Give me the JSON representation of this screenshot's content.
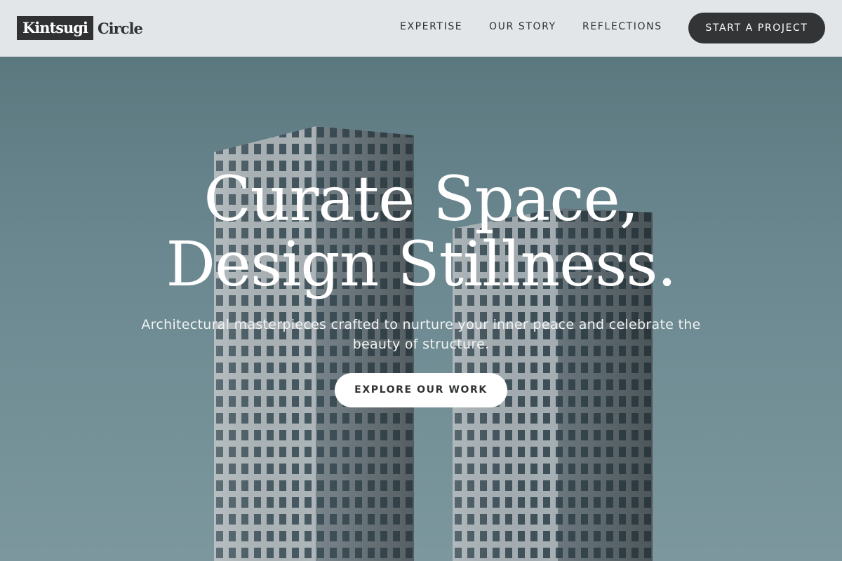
{
  "brand": {
    "logo_part1": "Kintsugi",
    "logo_part2": "Circle"
  },
  "nav": {
    "items": [
      {
        "label": "EXPERTISE"
      },
      {
        "label": "OUR STORY"
      },
      {
        "label": "REFLECTIONS"
      }
    ],
    "cta_label": "START A PROJECT"
  },
  "hero": {
    "headline_line1": "Curate Space,",
    "headline_line2": "Design Stillness.",
    "subtext": "Architectural masterpieces crafted to nurture your inner peace and celebrate the beauty of structure.",
    "button_label": "EXPLORE OUR WORK",
    "background_image": "twin-skyscrapers-photo"
  },
  "colors": {
    "header_bg": "#e2e6e9",
    "dark": "#2f3133",
    "hero_sky": "#6f8b92",
    "white": "#ffffff"
  }
}
